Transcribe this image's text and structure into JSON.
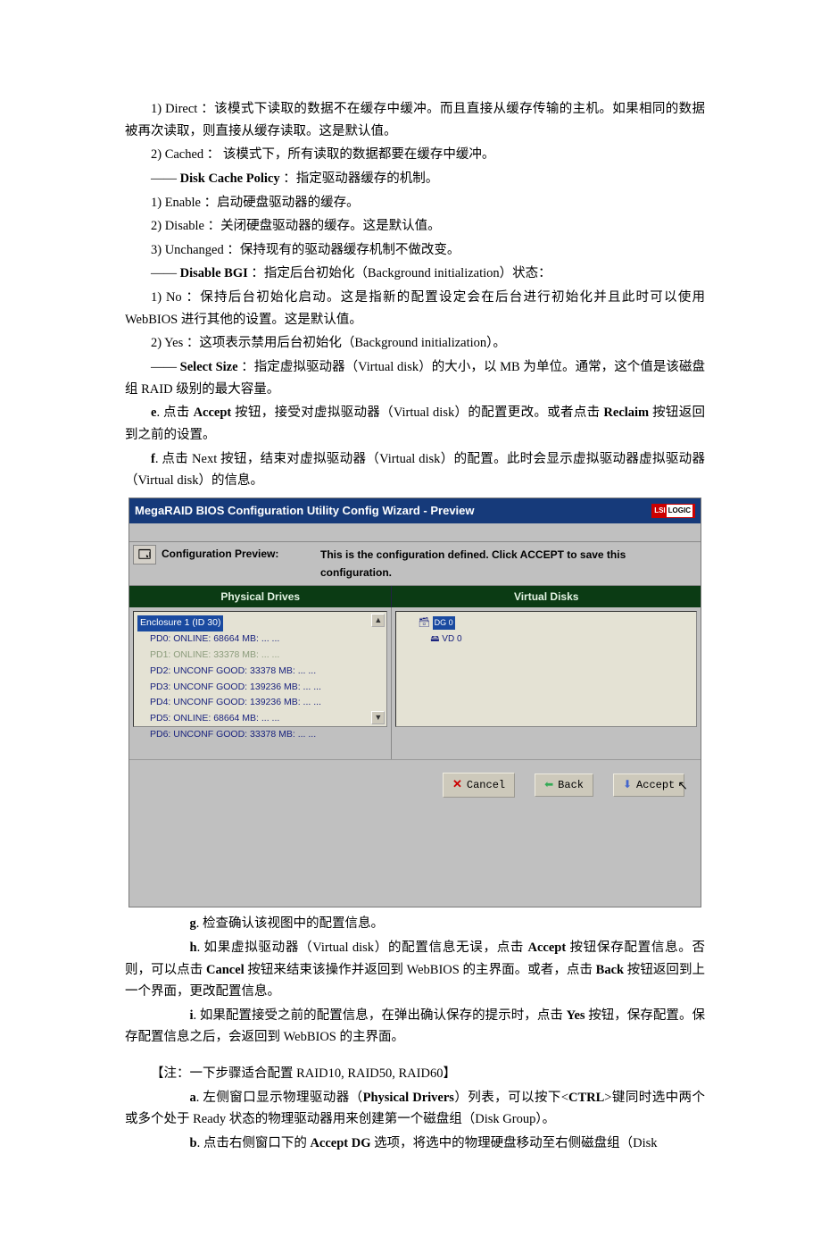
{
  "body": {
    "p1": "1) Direct ：该模式下读取的数据不在缓存中缓冲。而且直接从缓存传输的主机。如果相同的数据被再次读取，则直接从缓存读取。这是默认值。",
    "p2": "2) Cached ：  该模式下，所有读取的数据都要在缓存中缓冲。",
    "p3a": "—— ",
    "p3b": "Disk Cache Policy",
    "p3c": " ：指定驱动器缓存的机制。",
    "p4": "1) Enable ：启动硬盘驱动器的缓存。",
    "p5": "2) Disable ：关闭硬盘驱动器的缓存。这是默认值。",
    "p6": "3) Unchanged ：保持现有的驱动器缓存机制不做改变。",
    "p7a": "—— ",
    "p7b": "Disable BGI",
    "p7c": "  ：指定后台初始化（Background initialization）状态：",
    "p8": "1) No ：保持后台初始化启动。这是指新的配置设定会在后台进行初始化并且此时可以使用 WebBIOS 进行其他的设置。这是默认值。",
    "p9": "2) Yes ：这项表示禁用后台初始化（Background initialization）。",
    "p10a": "—— ",
    "p10b": "Select Size",
    "p10c": "  ：指定虚拟驱动器（Virtual disk）的大小，以 MB 为单位。通常，这个值是该磁盘组 RAID 级别的最大容量。",
    "p11a": "e",
    "p11b": ". 点击 ",
    "p11c": "Accept",
    "p11d": " 按钮，接受对虚拟驱动器（Virtual disk）的配置更改。或者点击 ",
    "p11e": "Reclaim",
    "p11f": " 按钮返回到之前的设置。",
    "p12a": "f",
    "p12b": ". 点击 Next 按钮，结束对虚拟驱动器（Virtual disk）的配置。此时会显示虚拟驱动器虚拟驱动器（Virtual disk）的信息。",
    "g1a": "g",
    "g1b": ". 检查确认该视图中的配置信息。",
    "h1a": "h",
    "h1b": ". 如果虚拟驱动器（Virtual disk）的配置信息无误，点击 ",
    "h1c": "Accept",
    "h1d": " 按钮保存配置信息。否则，可以点击 ",
    "h1e": "Cancel",
    "h1f": " 按钮来结束该操作并返回到 WebBIOS 的主界面。或者，点击 ",
    "h1g": "Back",
    "h1h": " 按钮返回到上一个界面，更改配置信息。",
    "i1a": "i",
    "i1b": ". 如果配置接受之前的配置信息，在弹出确认保存的提示时，点击 ",
    "i1c": "Yes",
    "i1d": " 按钮，保存配置。保存配置信息之后，会返回到 WebBIOS 的主界面。",
    "note": "【注：一下步骤适合配置 RAID10, RAID50, RAID60】",
    "a1a": "a",
    "a1b": ". 左侧窗口显示物理驱动器（",
    "a1c": "Physical Drivers",
    "a1d": "）列表，可以按下<",
    "a1e": "CTRL",
    "a1f": ">键同时选中两个或多个处于 Ready 状态的物理驱动器用来创建第一个磁盘组（Disk Group）。",
    "b1a": "b",
    "b1b": ". 点击右侧窗口下的 ",
    "b1c": "Accept DG",
    "b1d": " 选项，将选中的物理硬盘移动至右侧磁盘组（Disk"
  },
  "shot": {
    "title": "MegaRAID BIOS Configuration Utility Config Wizard - Preview",
    "logo_a": "LSI",
    "logo_b": "LOGIC",
    "preview_label": "Configuration Preview:",
    "preview_desc": "This is the configuration defined. Click ACCEPT to save this configuration.",
    "col_phys": "Physical Drives",
    "col_virt": "Virtual Disks",
    "enclosure": "Enclosure 1 (ID 30)",
    "pd": [
      "PD0: ONLINE: 68664 MB: ... ...",
      "PD1: ONLINE: 33378 MB: ... ...",
      "PD2: UNCONF GOOD: 33378 MB: ... ...",
      "PD3: UNCONF GOOD: 139236 MB: ... ...",
      "PD4: UNCONF GOOD: 139236 MB: ... ...",
      "PD5: ONLINE: 68664 MB: ... ...",
      "PD6: UNCONF GOOD: 33378 MB: ... ..."
    ],
    "dg": "DG 0",
    "vd": "VD 0",
    "btn_cancel": "Cancel",
    "btn_back": "Back",
    "btn_accept": "Accept"
  }
}
